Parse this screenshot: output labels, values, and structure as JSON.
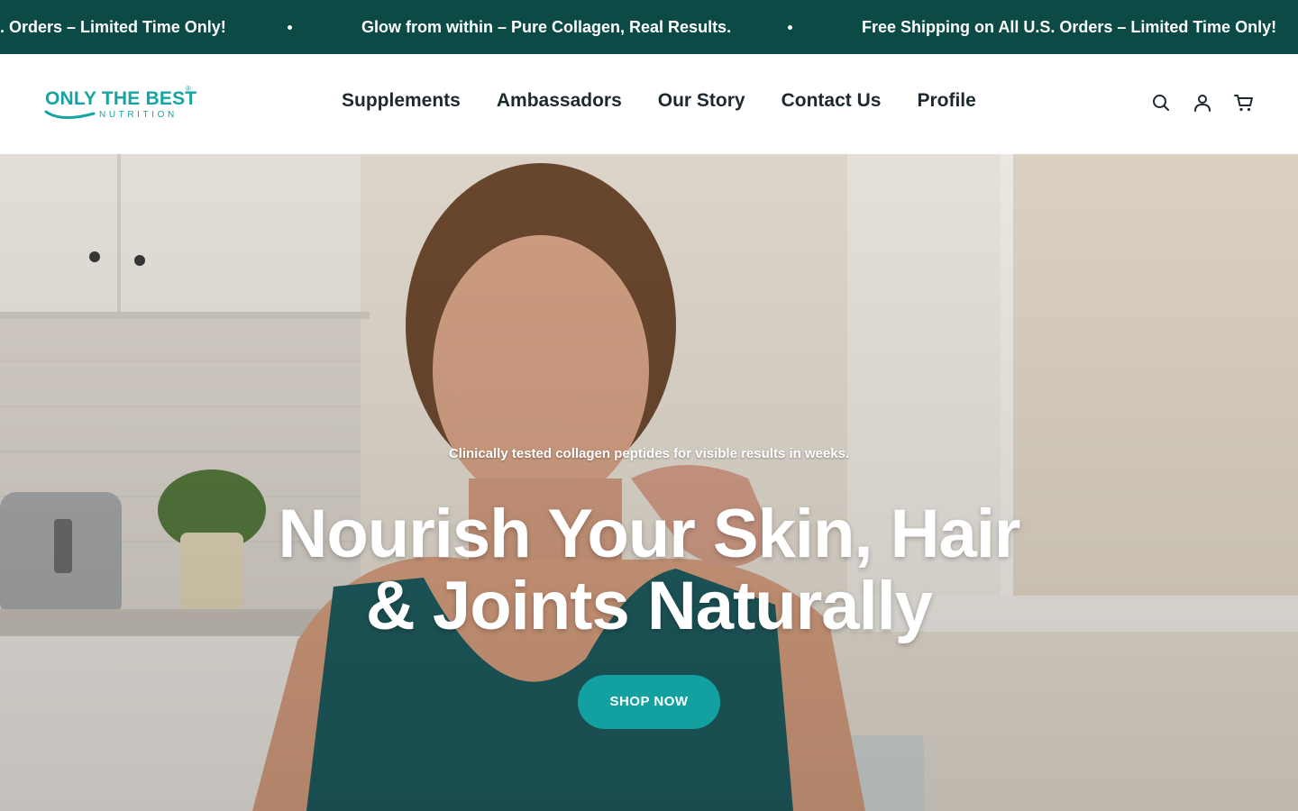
{
  "announcement": {
    "items": [
      ". Orders – Limited Time Only!",
      "Glow from within – Pure Collagen, Real Results.",
      "Free Shipping on All U.S. Orders – Limited Time Only!"
    ],
    "background": "#0b4a45"
  },
  "logo": {
    "main": "ONLY THE BEST",
    "sub": "NUTRITION",
    "reg": "®",
    "color": "#16a3a3"
  },
  "nav": {
    "items": [
      "Supplements",
      "Ambassadors",
      "Our Story",
      "Contact Us",
      "Profile"
    ]
  },
  "header_icons": [
    "search-icon",
    "account-icon",
    "cart-icon"
  ],
  "hero": {
    "subtitle": "Clinically tested collagen peptides for visible results in weeks.",
    "title_line1": "Nourish Your Skin, Hair",
    "title_line2": "& Joints Naturally",
    "cta": "SHOP NOW",
    "accent": "#12a0a0"
  }
}
